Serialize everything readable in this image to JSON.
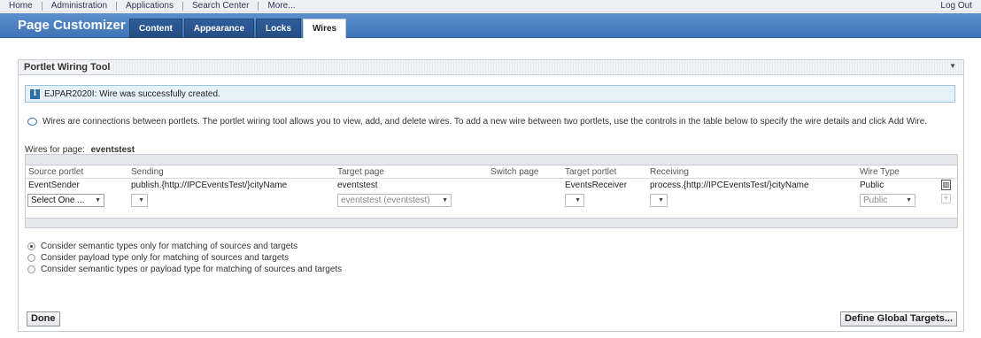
{
  "topnav": {
    "items": [
      "Home",
      "Administration",
      "Applications",
      "Search Center",
      "More..."
    ],
    "logout": "Log Out"
  },
  "header": {
    "title": "Page Customizer",
    "tabs": [
      "Content",
      "Appearance",
      "Locks",
      "Wires"
    ],
    "active_tab": "Wires"
  },
  "panel": {
    "title": "Portlet Wiring Tool",
    "message": "EJPAR2020I: Wire was successfully created.",
    "description": "Wires are connections between portlets. The portlet wiring tool allows you to view, add, and delete wires. To add a new wire between two portlets, use the controls in the table below to specify the wire details and click Add Wire.",
    "wires_for_label": "Wires for page:",
    "wires_for_page": "eventstest"
  },
  "table": {
    "columns": [
      "Source portlet",
      "Sending",
      "Target page",
      "Switch page",
      "Target portlet",
      "Receiving",
      "Wire Type"
    ],
    "rows": [
      {
        "source": "EventSender",
        "sending": "publish.{http://IPCEventsTest/}cityName",
        "target_page": "eventstest",
        "switch_page": "",
        "target_portlet": "EventsReceiver",
        "receiving": "process.{http://IPCEventsTest/}cityName",
        "wire_type": "Public"
      }
    ],
    "input_row": {
      "source": "Select One ...",
      "target_page": "eventstest (eventstest)",
      "wire_type": "Public"
    }
  },
  "options": [
    {
      "label": "Consider semantic types only for matching of sources and targets",
      "checked": true
    },
    {
      "label": "Consider payload type only for matching of sources and targets",
      "checked": false
    },
    {
      "label": "Consider semantic types or payload type for matching of sources and targets",
      "checked": false
    }
  ],
  "buttons": {
    "done": "Done",
    "define_global": "Define Global Targets..."
  }
}
